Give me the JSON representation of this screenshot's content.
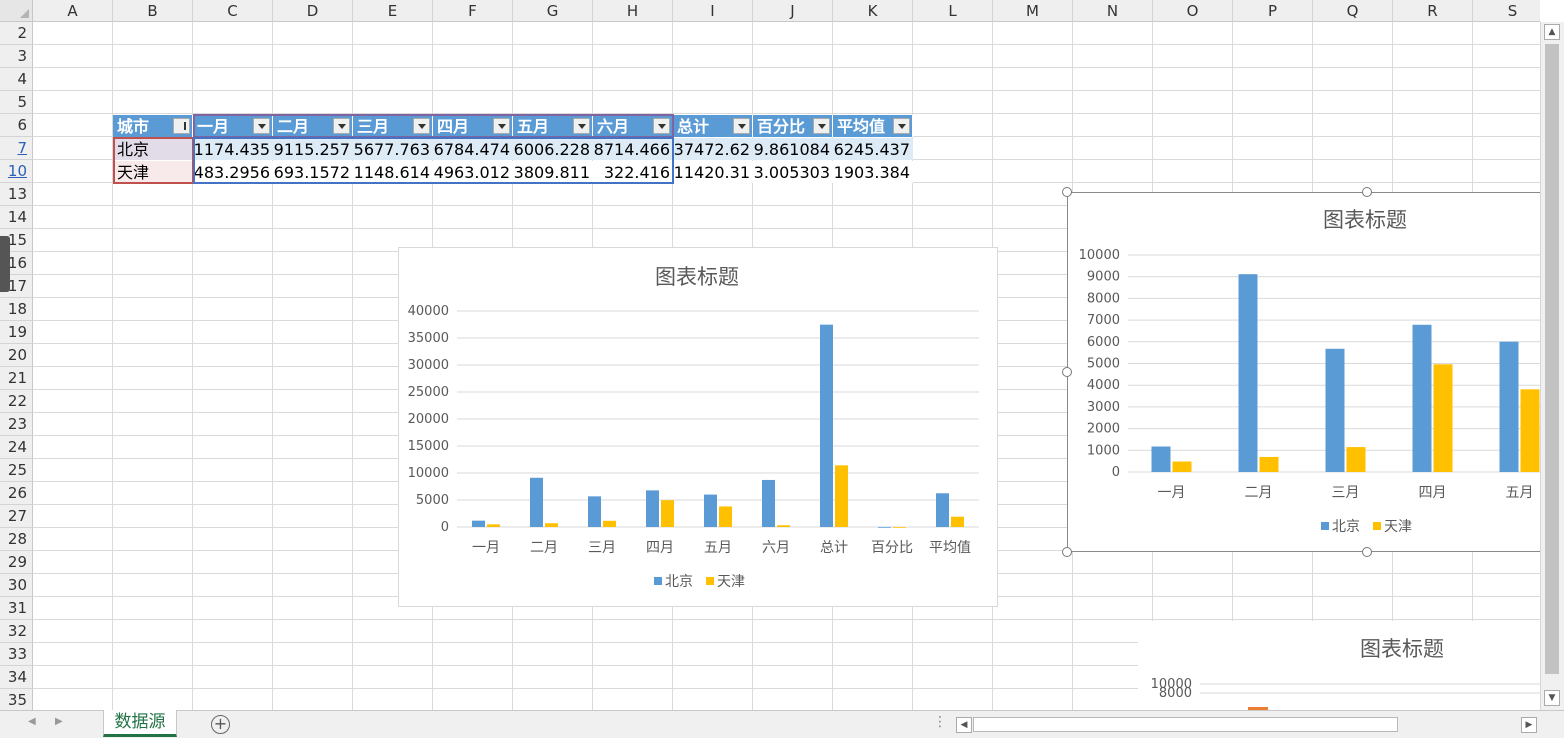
{
  "columns": [
    "A",
    "B",
    "C",
    "D",
    "E",
    "F",
    "G",
    "H",
    "I",
    "J",
    "K",
    "L",
    "M",
    "N",
    "O",
    "P",
    "Q",
    "R",
    "S"
  ],
  "rows": [
    "2",
    "3",
    "4",
    "5",
    "6",
    "7",
    "10",
    "13",
    "14",
    "15",
    "16",
    "17",
    "18",
    "19",
    "20",
    "21",
    "22",
    "23",
    "24",
    "25",
    "26",
    "27",
    "28",
    "29",
    "30",
    "31",
    "32",
    "33",
    "34",
    "35"
  ],
  "table": {
    "headers": [
      "城市",
      "一月",
      "二月",
      "三月",
      "四月",
      "五月",
      "六月",
      "总计",
      "百分比",
      "平均值"
    ],
    "rows": [
      [
        "北京",
        "1174.435",
        "9115.257",
        "5677.763",
        "6784.474",
        "6006.228",
        "8714.466",
        "37472.62",
        "9.861084",
        "6245.437"
      ],
      [
        "天津",
        "483.2956",
        "693.1572",
        "1148.614",
        "4963.012",
        "3809.811",
        "322.416",
        "11420.31",
        "3.005303",
        "1903.384"
      ]
    ]
  },
  "colors": {
    "beijing": "#5b9bd5",
    "tianjin": "#ffc000",
    "third_series": "#ed7d31",
    "sheet_tab": "#217346"
  },
  "chart_data": [
    {
      "type": "bar",
      "title": "图表标题",
      "categories": [
        "一月",
        "二月",
        "三月",
        "四月",
        "五月",
        "六月",
        "总计",
        "百分比",
        "平均值"
      ],
      "series": [
        {
          "name": "北京",
          "values": [
            1174.435,
            9115.257,
            5677.763,
            6784.474,
            6006.228,
            8714.466,
            37472.62,
            9.861084,
            6245.437
          ]
        },
        {
          "name": "天津",
          "values": [
            483.2956,
            693.1572,
            1148.614,
            4963.012,
            3809.811,
            322.416,
            11420.31,
            3.005303,
            1903.384
          ]
        }
      ],
      "ylim": [
        0,
        40000
      ],
      "yticks": [
        "0",
        "5000",
        "10000",
        "15000",
        "20000",
        "25000",
        "30000",
        "35000",
        "40000"
      ],
      "grid": true,
      "legend": "bottom"
    },
    {
      "type": "bar",
      "title": "图表标题",
      "categories": [
        "一月",
        "二月",
        "三月",
        "四月",
        "五月"
      ],
      "series": [
        {
          "name": "北京",
          "values": [
            1174.435,
            9115.257,
            5677.763,
            6784.474,
            6006.228
          ]
        },
        {
          "name": "天津",
          "values": [
            483.2956,
            693.1572,
            1148.614,
            4963.012,
            3809.811
          ]
        }
      ],
      "ylim": [
        0,
        10000
      ],
      "yticks": [
        "0",
        "1000",
        "2000",
        "3000",
        "4000",
        "5000",
        "6000",
        "7000",
        "8000",
        "9000",
        "10000"
      ],
      "grid": true,
      "legend": "bottom"
    },
    {
      "type": "bar",
      "title": "图表标题",
      "yticks": [
        "10000",
        "8000"
      ],
      "ylim": [
        0,
        10000
      ]
    }
  ],
  "sheet_tab": "数据源",
  "add_sheet_icon": "plus-circle-icon"
}
